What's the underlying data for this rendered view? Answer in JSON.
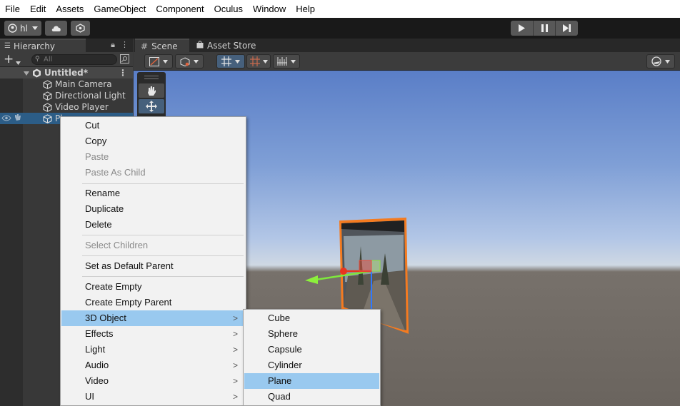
{
  "menubar": [
    "File",
    "Edit",
    "Assets",
    "GameObject",
    "Component",
    "Oculus",
    "Window",
    "Help"
  ],
  "toolbar": {
    "account_label": "hl",
    "play_icons": [
      "play-icon",
      "pause-icon",
      "step-icon"
    ]
  },
  "hierarchy": {
    "tab_label": "Hierarchy",
    "search_placeholder": "All",
    "scene_name": "Untitled*",
    "items": [
      "Main Camera",
      "Directional Light",
      "Video Player",
      "Pl"
    ]
  },
  "scene": {
    "tabs": [
      "Scene",
      "Asset Store"
    ],
    "tools": [
      "hand-tool-icon",
      "move-tool-icon"
    ]
  },
  "context_menu": {
    "items": [
      {
        "label": "Cut",
        "enabled": true
      },
      {
        "label": "Copy",
        "enabled": true
      },
      {
        "label": "Paste",
        "enabled": false
      },
      {
        "label": "Paste As Child",
        "enabled": false
      },
      {
        "label": "Rename",
        "enabled": true
      },
      {
        "label": "Duplicate",
        "enabled": true
      },
      {
        "label": "Delete",
        "enabled": true
      },
      {
        "label": "Select Children",
        "enabled": false
      },
      {
        "label": "Set as Default Parent",
        "enabled": true
      },
      {
        "label": "Create Empty",
        "enabled": true
      },
      {
        "label": "Create Empty Parent",
        "enabled": true
      },
      {
        "label": "3D Object",
        "enabled": true,
        "submenu": true,
        "highlighted": true
      },
      {
        "label": "Effects",
        "enabled": true,
        "submenu": true
      },
      {
        "label": "Light",
        "enabled": true,
        "submenu": true
      },
      {
        "label": "Audio",
        "enabled": true,
        "submenu": true
      },
      {
        "label": "Video",
        "enabled": true,
        "submenu": true
      },
      {
        "label": "UI",
        "enabled": true,
        "submenu": true
      }
    ],
    "submenu_arrow": ">"
  },
  "submenu_3d": {
    "items": [
      "Cube",
      "Sphere",
      "Capsule",
      "Cylinder",
      "Plane",
      "Quad"
    ],
    "highlighted": "Plane"
  },
  "colors": {
    "selection": "#2c5d87",
    "menu_highlight": "#99c9ef",
    "outline_orange": "#f47b20"
  }
}
